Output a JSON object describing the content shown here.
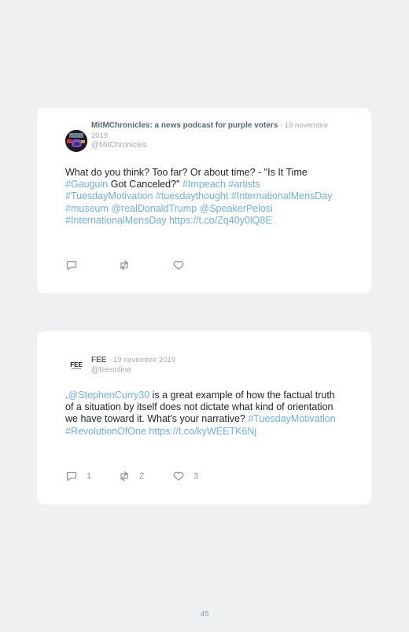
{
  "tweets": [
    {
      "author": "MitMChronicles: a news podcast for purple voters",
      "separator": " · ",
      "date": "19 novembre 2019",
      "handle": "@MitChronicles",
      "body": [
        {
          "t": "What do you think? Too far? Or about time? - \"Is It Time ",
          "link": false
        },
        {
          "t": "#Gauguin",
          "link": true
        },
        {
          "t": " Got Canceled?\" ",
          "link": false
        },
        {
          "t": "#Impeach",
          "link": true
        },
        {
          "t": " ",
          "link": false
        },
        {
          "t": "#artists",
          "link": true
        },
        {
          "t": " ",
          "link": false
        },
        {
          "t": "#TuesdayMotivation",
          "link": true
        },
        {
          "t": " ",
          "link": false
        },
        {
          "t": "#tuesdaythought",
          "link": true
        },
        {
          "t": " ",
          "link": false
        },
        {
          "t": "#InternationalMensDay",
          "link": true
        },
        {
          "t": " ",
          "link": false
        },
        {
          "t": "#museum",
          "link": true
        },
        {
          "t": " ",
          "link": false
        },
        {
          "t": "@realDonaldTrump",
          "link": true
        },
        {
          "t": " ",
          "link": false
        },
        {
          "t": "@SpeakerPelosi",
          "link": true
        },
        {
          "t": " ",
          "link": false
        },
        {
          "t": "#InternationalMensDay",
          "link": true
        },
        {
          "t": " ",
          "link": false
        },
        {
          "t": "https://t.co/Zq40y0lQ8E",
          "link": true
        }
      ],
      "counts": {
        "reply": "",
        "retweet": "",
        "like": ""
      }
    },
    {
      "author": "FEE",
      "separator": " · ",
      "date": "19 novembre 2019",
      "handle": "@feeonline",
      "avatar_text": "FEE",
      "body": [
        {
          "t": ".",
          "link": false
        },
        {
          "t": "@StephenCurry30",
          "link": true
        },
        {
          "t": " is a great example of how the factual truth of a situation by itself does not dictate what kind of orientation we have toward it. What's your narrative? ",
          "link": false
        },
        {
          "t": "#TuesdayMotivation",
          "link": true
        },
        {
          "t": " ",
          "link": false
        },
        {
          "t": "#RevolutionOfOne",
          "link": true
        },
        {
          "t": " ",
          "link": false
        },
        {
          "t": "https://t.co/kyWEETK6Nj",
          "link": true
        }
      ],
      "counts": {
        "reply": "1",
        "retweet": "2",
        "like": "3"
      }
    }
  ],
  "icons": {
    "reply": "reply-icon",
    "retweet": "retweet-icon",
    "like": "heart-icon"
  },
  "colors": {
    "link": "#6fb0e6",
    "icon": "#8b96a0",
    "muted": "#a3acb5",
    "card": "#ffffff",
    "page": "#eef0f2"
  },
  "page_number": "45"
}
